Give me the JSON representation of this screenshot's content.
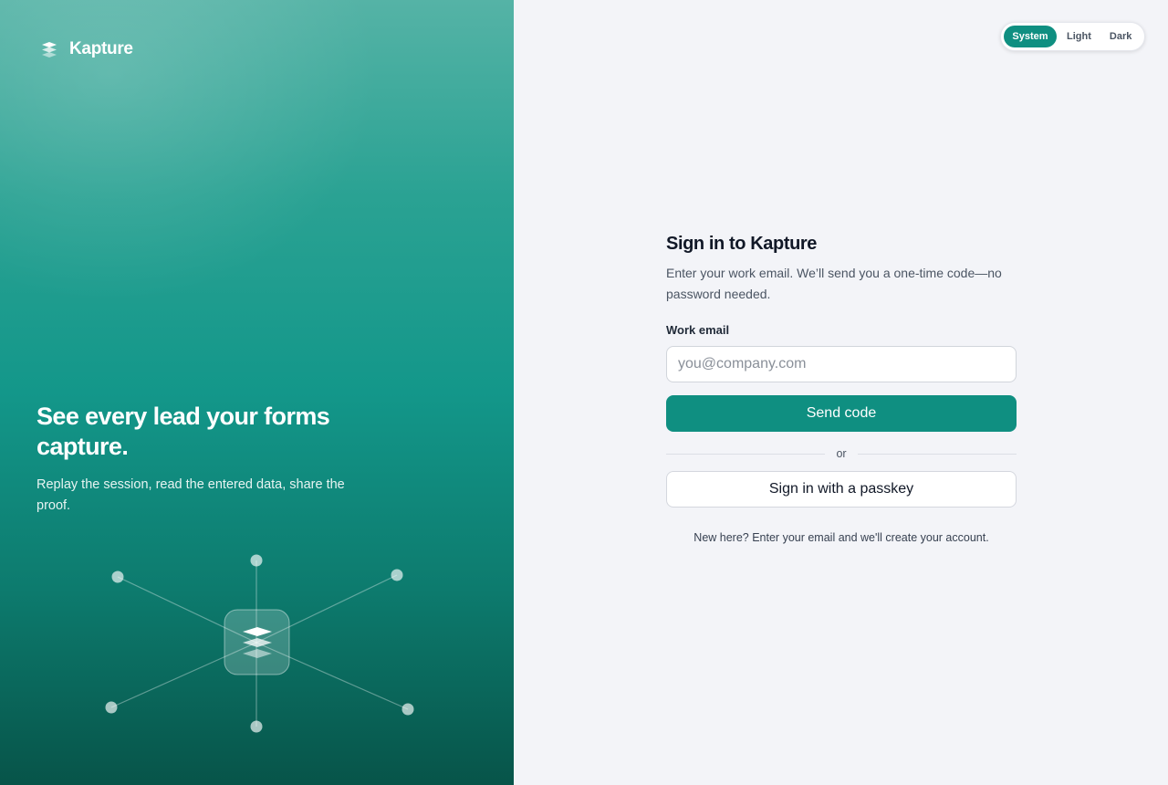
{
  "brand": {
    "name": "Kapture",
    "icon": "layers-stack-icon"
  },
  "hero": {
    "headline": "See every lead your forms capture.",
    "subline": "Replay the session, read the entered data, share the proof.",
    "illustration": "network-hub-illustration"
  },
  "theme_toggle": {
    "options": [
      "System",
      "Light",
      "Dark"
    ],
    "selected": "System"
  },
  "signin": {
    "title": "Sign in to Kapture",
    "description": "Enter your work email. We’ll send you a one-time code—no password needed.",
    "email_label": "Work email",
    "email_placeholder": "you@company.com",
    "email_value": "",
    "send_button": "Send code",
    "divider": "or",
    "passkey_button": "Sign in with a passkey",
    "footnote": "New here? Enter your email and we'll create your account."
  },
  "colors": {
    "accent": "#0f8f81",
    "hero_top": "#55b3a6",
    "hero_bottom": "#075449",
    "page_bg": "#f3f4f8"
  }
}
